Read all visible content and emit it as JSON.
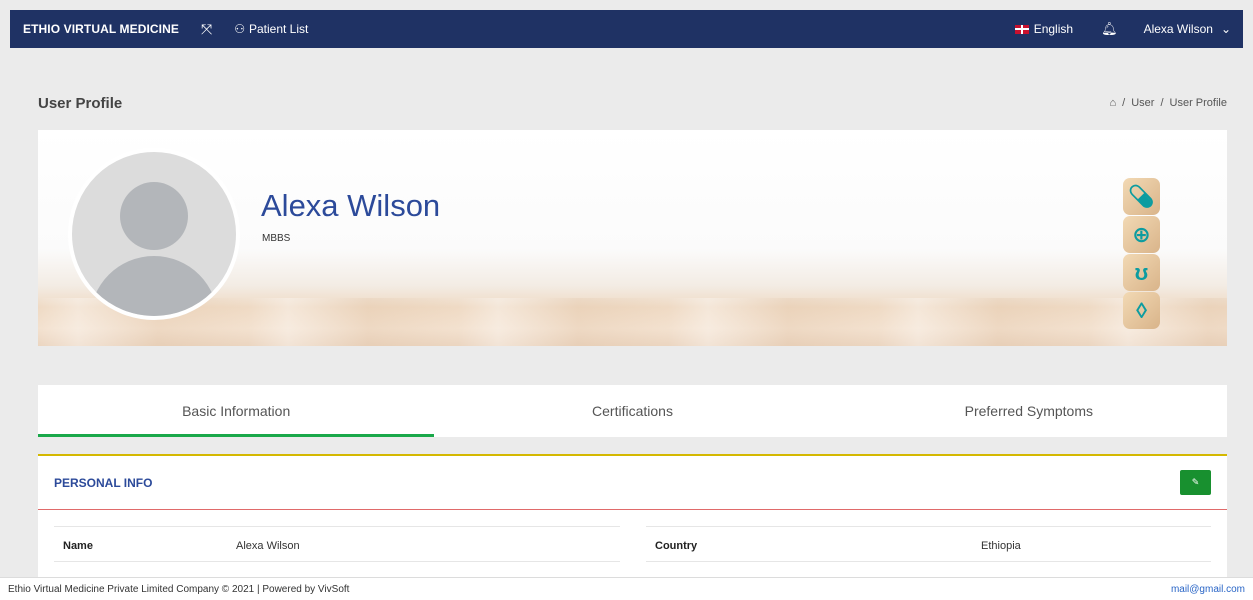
{
  "nav": {
    "brand": "ETHIO VIRTUAL MEDICINE",
    "patient_list": "Patient List",
    "language": "English",
    "user": "Alexa Wilson"
  },
  "page": {
    "title": "User Profile",
    "breadcrumb": [
      "User",
      "User Profile"
    ]
  },
  "profile": {
    "name": "Alexa Wilson",
    "degree": "MBBS"
  },
  "tabs": [
    {
      "label": "Basic Information",
      "active": true
    },
    {
      "label": "Certifications",
      "active": false
    },
    {
      "label": "Preferred Symptoms",
      "active": false
    }
  ],
  "personal_info": {
    "title": "PERSONAL INFO",
    "rows": [
      {
        "label": "Name",
        "value": "Alexa Wilson"
      },
      {
        "label": "Country",
        "value": "Ethiopia"
      }
    ]
  },
  "footer": {
    "text": "Ethio Virtual Medicine Private Limited Company © 2021 | Powered by VivSoft",
    "email": "mail@gmail.com"
  },
  "colors": {
    "navbar": "#1f3264",
    "accent_blue": "#2c4a9a",
    "active_tab": "#1aa84a",
    "edit_button": "#18902f",
    "card_top": "#d4b800"
  }
}
